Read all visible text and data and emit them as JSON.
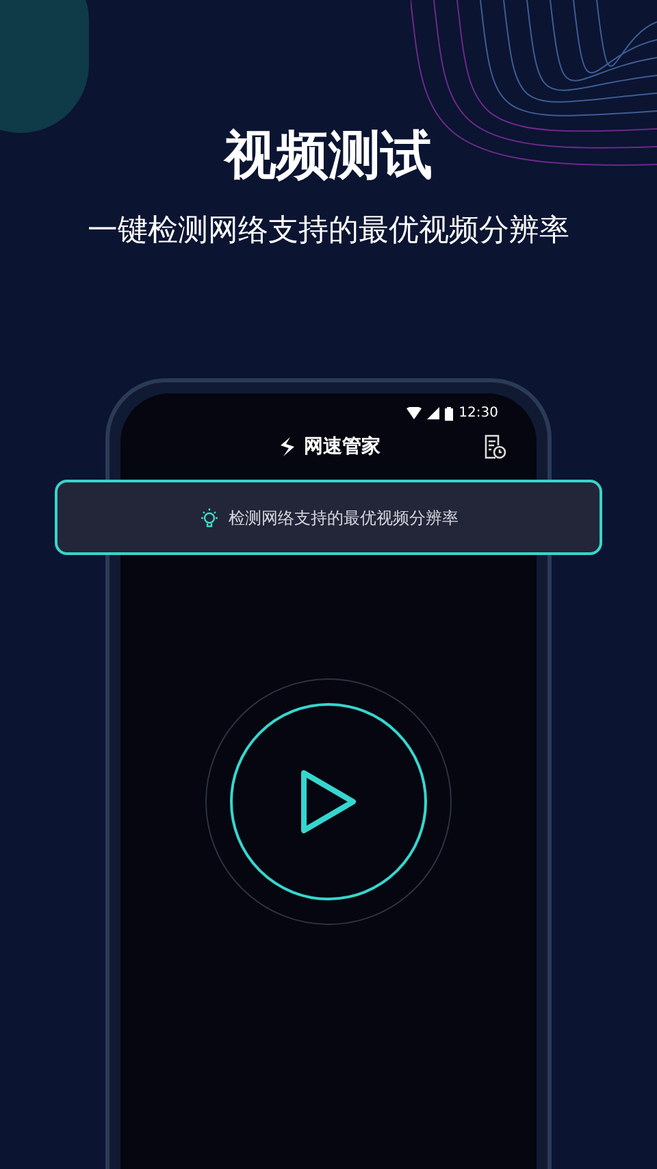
{
  "header": {
    "title": "视频测试",
    "subtitle": "一键检测网络支持的最优视频分辨率"
  },
  "phone": {
    "status_bar": {
      "time": "12:30"
    },
    "app_title": "网速管家",
    "tip": "检测网络支持的最优视频分辨率"
  }
}
